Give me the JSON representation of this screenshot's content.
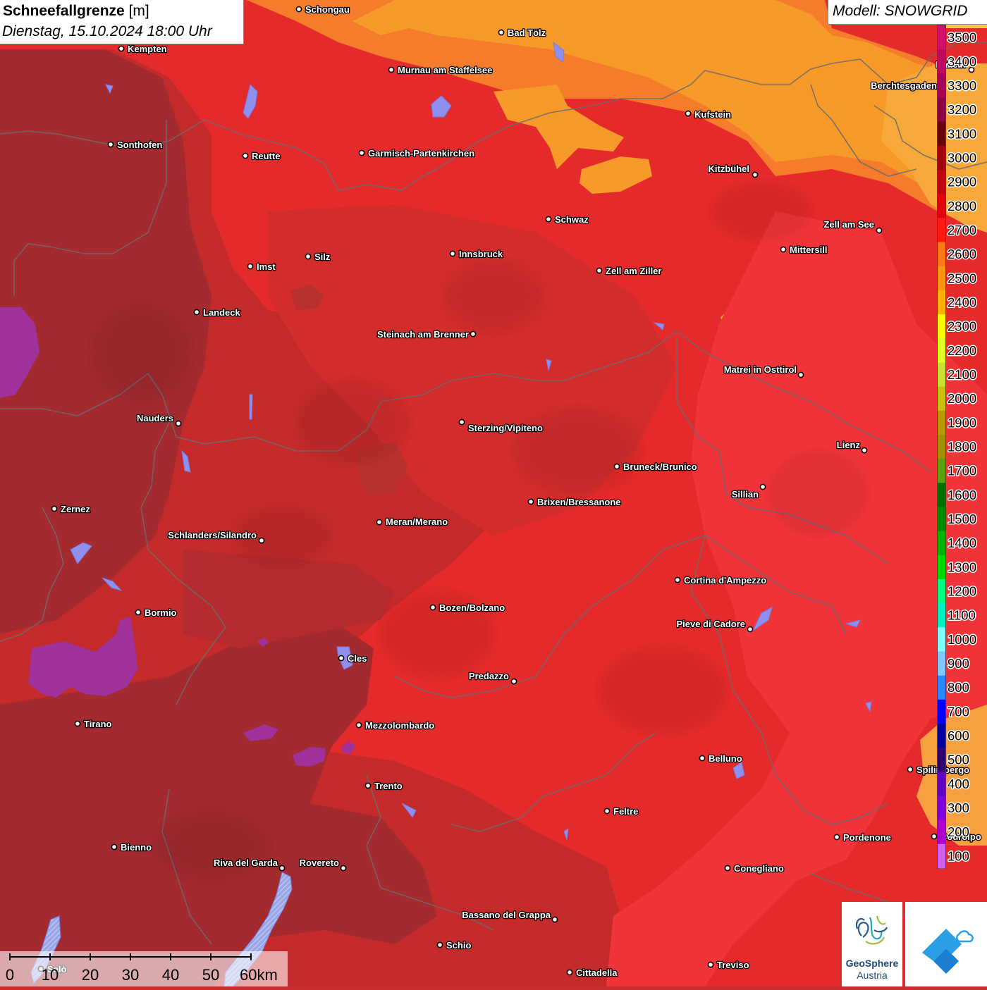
{
  "title": {
    "parameter": "Schneefallgrenze",
    "unit": "[m]",
    "datetime": "Dienstag, 15.10.2024 18:00 Uhr"
  },
  "model_label": "Modell: SNOWGRID",
  "legend": {
    "items": [
      {
        "label": "3500",
        "color": "#d0106a"
      },
      {
        "label": "3400",
        "color": "#c00a62"
      },
      {
        "label": "3300",
        "color": "#a80058"
      },
      {
        "label": "3200",
        "color": "#8c0048"
      },
      {
        "label": "3100",
        "color": "#6a0008"
      },
      {
        "label": "3000",
        "color": "#a00010"
      },
      {
        "label": "2900",
        "color": "#c00010"
      },
      {
        "label": "2800",
        "color": "#e00010"
      },
      {
        "label": "2700",
        "color": "#ff1a10"
      },
      {
        "label": "2600",
        "color": "#ff7818"
      },
      {
        "label": "2500",
        "color": "#ff9410"
      },
      {
        "label": "2400",
        "color": "#ffb000"
      },
      {
        "label": "2300",
        "color": "#ffff00"
      },
      {
        "label": "2200",
        "color": "#e0ff20"
      },
      {
        "label": "2100",
        "color": "#c8e030"
      },
      {
        "label": "2000",
        "color": "#c8c010"
      },
      {
        "label": "1900",
        "color": "#b89800"
      },
      {
        "label": "1800",
        "color": "#a09000"
      },
      {
        "label": "1700",
        "color": "#58a010"
      },
      {
        "label": "1600",
        "color": "#007000"
      },
      {
        "label": "1500",
        "color": "#008c00"
      },
      {
        "label": "1400",
        "color": "#00b400"
      },
      {
        "label": "1300",
        "color": "#00d800"
      },
      {
        "label": "1200",
        "color": "#00ff80"
      },
      {
        "label": "1100",
        "color": "#00f0c0"
      },
      {
        "label": "1000",
        "color": "#80ffff"
      },
      {
        "label": "900",
        "color": "#80c8ff"
      },
      {
        "label": "800",
        "color": "#2888ff"
      },
      {
        "label": "700",
        "color": "#0000ff"
      },
      {
        "label": "600",
        "color": "#0000a0"
      },
      {
        "label": "500",
        "color": "#300070"
      },
      {
        "label": "400",
        "color": "#6000c0"
      },
      {
        "label": "300",
        "color": "#8000e0"
      },
      {
        "label": "200",
        "color": "#b000d0"
      },
      {
        "label": "100",
        "color": "#d060f0"
      }
    ]
  },
  "cities": [
    {
      "name": "Schongau"
    },
    {
      "name": "Bad Tölz"
    },
    {
      "name": "Kempten"
    },
    {
      "name": "Murnau am Staffelsee"
    },
    {
      "name": "Berchtesgaden"
    },
    {
      "name": "Hallein"
    },
    {
      "name": "Kufstein"
    },
    {
      "name": "Sonthofen"
    },
    {
      "name": "Reutte"
    },
    {
      "name": "Garmisch-Partenkirchen"
    },
    {
      "name": "Kitzbühel"
    },
    {
      "name": "Schwaz"
    },
    {
      "name": "Zell am See"
    },
    {
      "name": "Innsbruck"
    },
    {
      "name": "Mittersill"
    },
    {
      "name": "Silz"
    },
    {
      "name": "Imst"
    },
    {
      "name": "Zell am Ziller"
    },
    {
      "name": "Landeck"
    },
    {
      "name": "Steinach am Brenner"
    },
    {
      "name": "Matrei in Osttirol"
    },
    {
      "name": "Nauders"
    },
    {
      "name": "Sterzing/Vipiteno"
    },
    {
      "name": "Lienz"
    },
    {
      "name": "Bruneck/Brunico"
    },
    {
      "name": "Sillian"
    },
    {
      "name": "Brixen/Bressanone"
    },
    {
      "name": "Zernez"
    },
    {
      "name": "Meran/Merano"
    },
    {
      "name": "Schlanders/Silandro"
    },
    {
      "name": "Cortina d'Ampezzo"
    },
    {
      "name": "Bozen/Bolzano"
    },
    {
      "name": "Bormio"
    },
    {
      "name": "Pieve di Cadore"
    },
    {
      "name": "Cles"
    },
    {
      "name": "Predazzo"
    },
    {
      "name": "Tirano"
    },
    {
      "name": "Mezzolombardo"
    },
    {
      "name": "Belluno"
    },
    {
      "name": "Spilimbergo"
    },
    {
      "name": "Trento"
    },
    {
      "name": "Feltre"
    },
    {
      "name": "Pordenone"
    },
    {
      "name": "Bienno"
    },
    {
      "name": "Riva del Garda"
    },
    {
      "name": "Rovereto"
    },
    {
      "name": "Conegliano"
    },
    {
      "name": "Bassano del Grappa"
    },
    {
      "name": "Schio"
    },
    {
      "name": "Treviso"
    },
    {
      "name": "Cittadella"
    },
    {
      "name": "Salò"
    },
    {
      "name": "Codroipo"
    }
  ],
  "scale_bar": {
    "ticks": [
      "0",
      "10",
      "20",
      "30",
      "40",
      "50"
    ],
    "end_label": "60km"
  },
  "logos": {
    "geosphere_line1": "GeoSphere",
    "geosphere_line2": "Austria"
  }
}
